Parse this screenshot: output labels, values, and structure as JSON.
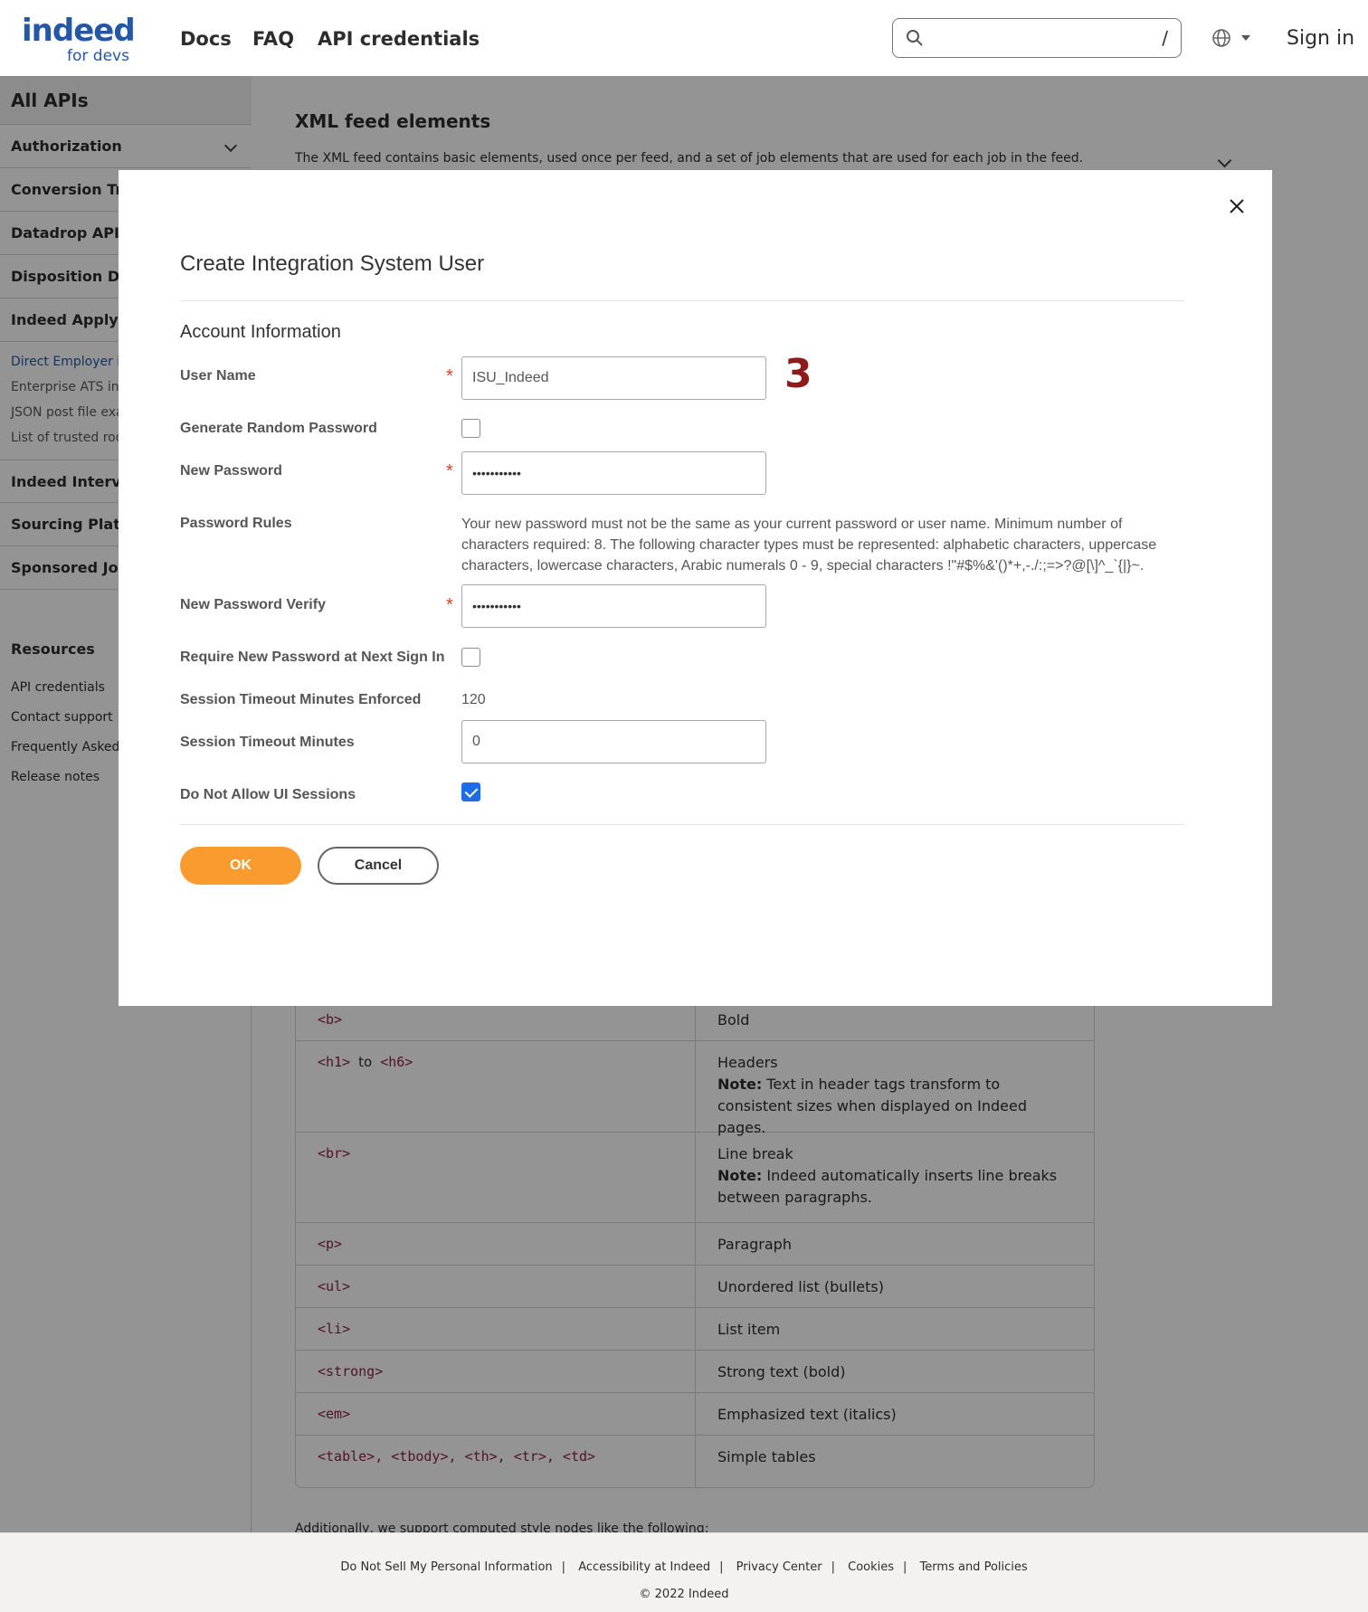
{
  "header": {
    "logo_main": "indeed",
    "logo_sub": "for devs",
    "nav": [
      "Docs",
      "FAQ",
      "API credentials"
    ],
    "search_shortcut": "/",
    "sign_in": "Sign in"
  },
  "sidebar": {
    "title": "All APIs",
    "items": [
      "Authorization",
      "Conversion Tra",
      "Datadrop API",
      "Disposition Dat",
      "Indeed Apply"
    ],
    "sub_items": [
      "Direct Employer in",
      "Enterprise ATS inte",
      "JSON post file exam",
      "List of trusted roo"
    ],
    "items2": [
      "Indeed Intervie",
      "Sourcing Platfr",
      "Sponsored Jobs"
    ],
    "resources_title": "Resources",
    "resources": [
      "API credentials",
      "Contact support",
      "Frequently Asked",
      "Release notes"
    ]
  },
  "main": {
    "title": "XML feed elements",
    "intro": "The XML feed contains basic elements, used once per feed, and a set of job elements that are used for each job in the feed.",
    "rows": [
      {
        "tag": "<b>",
        "desc": "Bold",
        "note": ""
      },
      {
        "tag": "<h1>",
        "tag_sep": "to",
        "tag2": "<h6>",
        "desc": "Headers",
        "note_label": "Note:",
        "note": "Text in header tags transform to consistent sizes when displayed on Indeed pages."
      },
      {
        "tag": "<br>",
        "desc": "Line break",
        "note_label": "Note:",
        "note": "Indeed automatically inserts line breaks between paragraphs."
      },
      {
        "tag": "<p>",
        "desc": "Paragraph"
      },
      {
        "tag": "<ul>",
        "desc": "Unordered list (bullets)"
      },
      {
        "tag": "<li>",
        "desc": "List item"
      },
      {
        "tag": "<strong>",
        "desc": "Strong text (bold)"
      },
      {
        "tag": "<em>",
        "desc": "Emphasized text (italics)"
      },
      {
        "tag": "<table>, <tbody>, <th>, <tr>, <td>",
        "desc": "Simple tables"
      }
    ],
    "after_text": "Additionally, we support computed style nodes like the following:"
  },
  "footer": {
    "links": [
      "Do Not Sell My Personal Information",
      "Accessibility at Indeed",
      "Privacy Center",
      "Cookies",
      "Terms and Policies"
    ],
    "copyright": "© 2022 Indeed"
  },
  "modal": {
    "title": "Create Integration System User",
    "section": "Account Information",
    "fields": {
      "user_name_label": "User Name",
      "user_name_value": "ISU_Indeed",
      "gen_pw_label": "Generate Random Password",
      "gen_pw_checked": false,
      "new_pw_label": "New Password",
      "new_pw_value": "•••••••••••",
      "rules_label": "Password Rules",
      "rules_text_1": "Your new password must not be the same as your current password or user name. Minimum number of",
      "rules_text_2": "characters required: 8. The following character types must be represented: alphabetic characters, uppercase",
      "rules_text_3": "characters, lowercase characters, Arabic numerals 0 - 9, special characters !\"#$%&'()*+,-./:;=>?@[\\]^_`{|}~.",
      "pw_verify_label": "New Password Verify",
      "pw_verify_value": "•••••••••••",
      "require_new_label": "Require New Password at Next Sign In",
      "require_new_checked": false,
      "timeout_enforced_label": "Session Timeout Minutes Enforced",
      "timeout_enforced_value": "120",
      "timeout_label": "Session Timeout Minutes",
      "timeout_value": "0",
      "no_ui_label": "Do Not Allow UI Sessions",
      "no_ui_checked": true
    },
    "step_number": "3",
    "ok_label": "OK",
    "cancel_label": "Cancel"
  },
  "colors": {
    "brand_blue": "#2557a7",
    "ok_orange": "#f99b2e",
    "checkbox_blue": "#1e6de5",
    "step_red": "#8e1b1b",
    "required_red": "#e23b2a"
  }
}
